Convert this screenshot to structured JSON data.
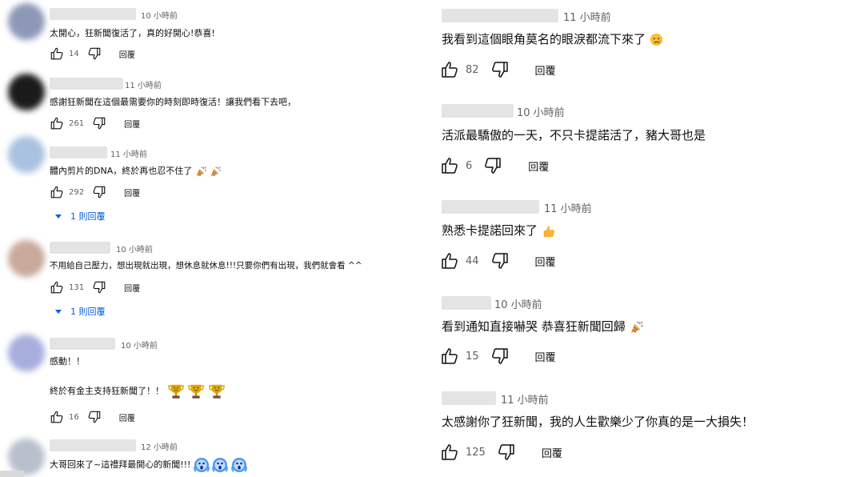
{
  "left_comments": [
    {
      "time": "10 小時前",
      "text": "太開心，狂新聞復活了，真的好開心!恭喜!",
      "likes": "14",
      "reply_label": "回覆",
      "avatar_color": "#8d98b8"
    },
    {
      "time": "11 小時前",
      "text": "感謝狂新聞在這個最需要你的時刻即時復活！讓我們看下去吧，",
      "likes": "261",
      "reply_label": "回覆",
      "avatar_color": "#1a1a1a"
    },
    {
      "time": "11 小時前",
      "text": "體內剪片的DNA，終於再也忍不住了",
      "likes": "292",
      "reply_label": "回覆",
      "replies_label": "1 則回覆",
      "avatar_color": "#a9c2df"
    },
    {
      "time": "10 小時前",
      "text": "不用給自己壓力，想出現就出現，想休息就休息!!!只要你們有出現，我們就會看 ^^",
      "likes": "131",
      "reply_label": "回覆",
      "replies_label": "1 則回覆",
      "avatar_color": "#c9a99a"
    },
    {
      "time": "10 小時前",
      "text": "感動！！",
      "text2": "終於有金主支持狂新聞了！！",
      "likes": "16",
      "reply_label": "回覆",
      "avatar_color": "#a7addd"
    },
    {
      "time": "12 小時前",
      "text": "大哥回來了~這禮拜最開心的新聞!!!",
      "avatar_color": "#b8c0cc"
    }
  ],
  "right_comments": [
    {
      "time": "11 小時前",
      "text": "我看到這個眼角莫名的眼淚都流下來了",
      "likes": "82",
      "reply_label": "回覆"
    },
    {
      "time": "10 小時前",
      "text": "活派最驕傲的一天，不只卡提諾活了，豬大哥也是",
      "likes": "6",
      "reply_label": "回覆"
    },
    {
      "time": "11 小時前",
      "text": "熟悉卡提諾回來了",
      "likes": "44",
      "reply_label": "回覆"
    },
    {
      "time": "10 小時前",
      "text": "看到通知直接嚇哭 恭喜狂新聞回歸",
      "likes": "15",
      "reply_label": "回覆"
    },
    {
      "time": "11 小時前",
      "text": "太感謝你了狂新聞，我的人生歡樂少了你真的是一大損失！",
      "likes": "125",
      "reply_label": "回覆"
    }
  ],
  "icons": {
    "like": "thumb-up-icon",
    "dislike": "thumb-down-icon",
    "expand": "caret-down-icon",
    "party": "party-popper-emoji",
    "cry": "crying-face-emoji",
    "thumbs": "thumbs-up-emoji",
    "trophy": "trophy-emoji",
    "scream": "screaming-face-emoji"
  },
  "colors": {
    "text": "#0f0f0f",
    "secondary": "#606060",
    "link": "#065fd4",
    "name_blur": "#e4e4e4"
  }
}
